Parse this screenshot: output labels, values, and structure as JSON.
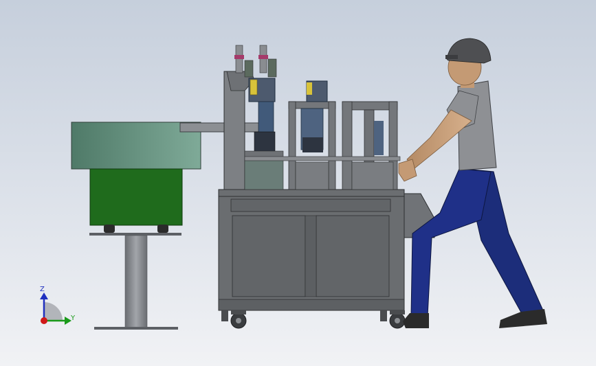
{
  "viewport": {
    "background_top": "#c6cfdc",
    "background_bottom": "#f1f2f5"
  },
  "colors": {
    "frame": "#6a6d70",
    "frame_dark": "#4a4c4f",
    "feeder_lid": "#5f8a78",
    "feeder_body": "#1f6b1c",
    "pedestal": "#7d8086",
    "skin": "#c49a74",
    "shirt": "#8e9094",
    "pants": "#1c2d7a",
    "helmet": "#4e4f52",
    "axis_z": "#1f2fbf",
    "axis_y": "#1a9a1a",
    "axis_x": "#d01818"
  },
  "axis_triad": {
    "z_label": "Z",
    "y_label": "Y"
  }
}
